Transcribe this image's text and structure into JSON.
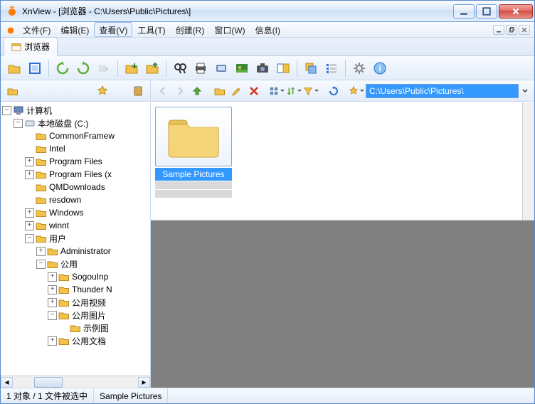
{
  "window": {
    "title": "XnView - [浏览器 - C:\\Users\\Public\\Pictures\\]"
  },
  "menu": {
    "file": "文件(F)",
    "edit": "编辑(E)",
    "view": "查看(V)",
    "tools": "工具(T)",
    "create": "创建(R)",
    "window": "窗口(W)",
    "info": "信息(I)"
  },
  "doctab": {
    "label": "浏览器"
  },
  "address": {
    "path": "C:\\Users\\Public\\Pictures\\"
  },
  "tree": {
    "root": "计算机",
    "drive": "本地磁盘 (C:)",
    "items": [
      "CommonFramew",
      "Intel",
      "Program Files",
      "Program Files (x",
      "QMDownloads",
      "resdown",
      "Windows",
      "winnt",
      "用户"
    ],
    "users_children": [
      "Administrator",
      "公用"
    ],
    "public_children": [
      "SogouInp",
      "Thunder N",
      "公用视频",
      "公用图片",
      "公用文档"
    ],
    "public_pictures_child": "示例图"
  },
  "thumbs": {
    "item_label": "Sample Pictures"
  },
  "status": {
    "count": "1 对象 / 1 文件被选中",
    "selected": "Sample Pictures"
  }
}
